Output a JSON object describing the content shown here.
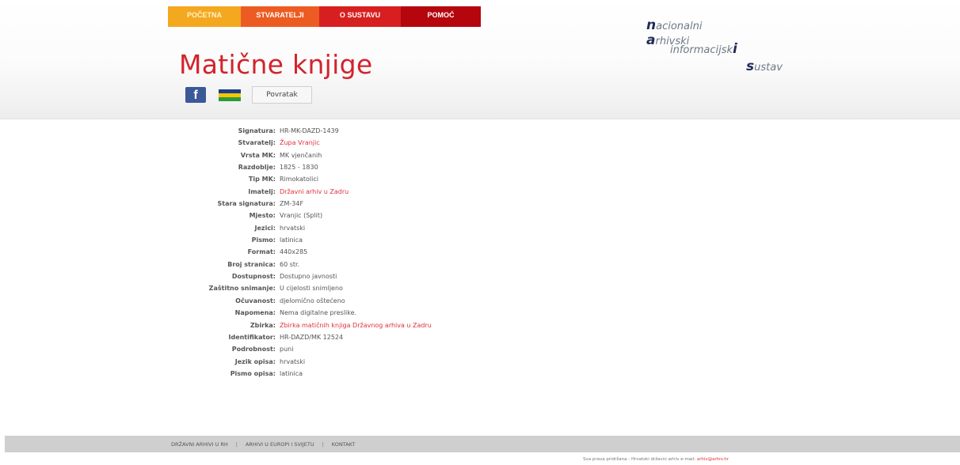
{
  "nav": {
    "tabs": [
      "POČETNA",
      "STVARATELJI",
      "O SUSTAVU",
      "POMOĆ"
    ]
  },
  "page": {
    "title": "Matične knjige"
  },
  "toolbar": {
    "back_label": "Povratak",
    "facebook_glyph": "f"
  },
  "logo": {
    "line1_initial": "n",
    "line1_rest": "acionalni",
    "line2_initial": "a",
    "line2_rest": "rhivski",
    "line3_rest": "informacijsk",
    "line3_initial": "i",
    "line4_initial": "s",
    "line4_rest": "ustav"
  },
  "details": [
    {
      "label": "Signatura:",
      "value": "HR-MK-DAZD-1439",
      "link": false
    },
    {
      "label": "Stvaratelj:",
      "value": "Župa Vranjic",
      "link": true
    },
    {
      "label": "Vrsta MK:",
      "value": "MK vjenčanih",
      "link": false
    },
    {
      "label": "Razdoblje:",
      "value": "1825 - 1830",
      "link": false
    },
    {
      "label": "Tip MK:",
      "value": "Rimokatolici",
      "link": false
    },
    {
      "label": "Imatelj:",
      "value": "Državni arhiv u Zadru",
      "link": true
    },
    {
      "label": "Stara signatura:",
      "value": "ZM-34F",
      "link": false
    },
    {
      "label": "Mjesto:",
      "value": "Vranjic (Split)",
      "link": false
    },
    {
      "label": "Jezici:",
      "value": "hrvatski",
      "link": false
    },
    {
      "label": "Pismo:",
      "value": "latinica",
      "link": false
    },
    {
      "label": "Format:",
      "value": "440x285",
      "link": false
    },
    {
      "label": "Broj stranica:",
      "value": "60 str.",
      "link": false
    },
    {
      "label": "Dostupnost:",
      "value": "Dostupno javnosti",
      "link": false
    },
    {
      "label": "Zaštitno snimanje:",
      "value": "U cijelosti snimljeno",
      "link": false
    },
    {
      "label": "Očuvanost:",
      "value": "djelomično oštećeno",
      "link": false
    },
    {
      "label": "Napomena:",
      "value": "Nema digitalne preslike.",
      "link": false
    },
    {
      "label": "Zbirka:",
      "value": "Zbirka matičnih knjiga Državnog arhiva u Zadru",
      "link": true
    },
    {
      "label": "Identifikator:",
      "value": "HR-DAZD/MK 12524",
      "link": false
    },
    {
      "label": "Podrobnost:",
      "value": "puni",
      "link": false
    },
    {
      "label": "Jezik opisa:",
      "value": "hrvatski",
      "link": false
    },
    {
      "label": "Pismo opisa:",
      "value": "latinica",
      "link": false
    }
  ],
  "footer": {
    "links": [
      "DRŽAVNI ARHIVI U RH",
      "ARHIVI U EUROPI I SVIJETU",
      "KONTAKT"
    ],
    "separator": "|",
    "copyright": "Sva prava pridržana - Hrvatski državni arhiv e-mail:",
    "email": "arhiv@arhiv.hr"
  },
  "colors": {
    "tab1": "#f4a81f",
    "tab2": "#ec5c22",
    "tab3": "#d81f1f",
    "tab4": "#b5060e",
    "title": "#d3232c",
    "link": "#e0303a",
    "footer_bar": "#cfcfcf"
  },
  "icons": [
    "facebook-icon",
    "flag-icon"
  ]
}
